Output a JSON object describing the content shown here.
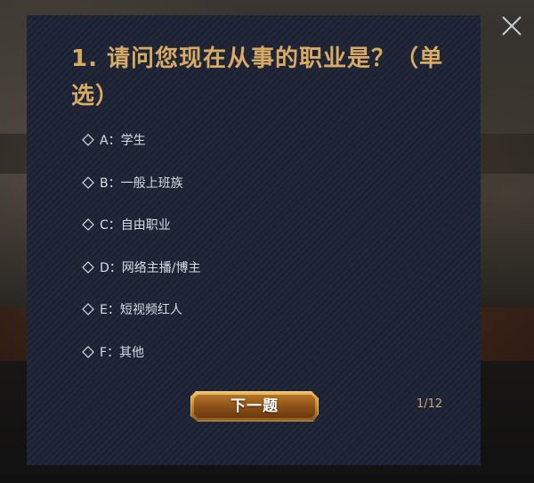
{
  "quiz": {
    "question_title": "1. 请问您现在从事的职业是？（单选）",
    "options": [
      {
        "label": "A：学生"
      },
      {
        "label": "B：一般上班族"
      },
      {
        "label": "C：自由职业"
      },
      {
        "label": "D：网络主播/博主"
      },
      {
        "label": "E：短视频红人"
      },
      {
        "label": "F：其他"
      }
    ],
    "next_button_label": "下一题",
    "page_counter": "1/12"
  },
  "icons": {
    "close": "close-icon",
    "option_marker": "diamond-outline-icon"
  },
  "colors": {
    "modal_background": "#1c2233",
    "title_gold": "#d7ab63",
    "option_text": "#d9dce3",
    "button_gold": "#c88a2f",
    "counter_text": "#c2a97a"
  }
}
